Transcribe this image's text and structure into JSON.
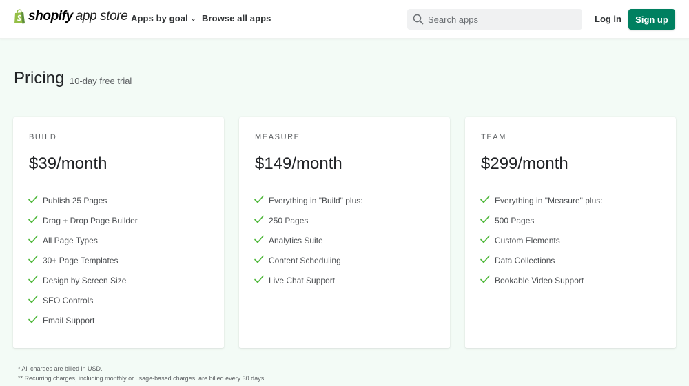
{
  "header": {
    "logo_word": "shopify",
    "logo_sub": "app store",
    "nav": [
      {
        "label": "Apps by goal",
        "has_dropdown": true
      },
      {
        "label": "Browse all apps",
        "has_dropdown": false
      }
    ],
    "search": {
      "placeholder": "Search apps",
      "value": "",
      "icon": "search-icon"
    },
    "login_label": "Log in",
    "signup_label": "Sign up",
    "brand_color": "#008060",
    "logo_color": "#95bf47"
  },
  "pricing": {
    "title": "Pricing",
    "trial": "10-day free trial",
    "plans": [
      {
        "name": "BUILD",
        "price": "$39/month",
        "features": [
          "Publish 25 Pages",
          "Drag + Drop Page Builder",
          "All Page Types",
          "30+ Page Templates",
          "Design by Screen Size",
          "SEO Controls",
          "Email Support"
        ]
      },
      {
        "name": "MEASURE",
        "price": "$149/month",
        "features": [
          "Everything in \"Build\" plus:",
          "250 Pages",
          "Analytics Suite",
          "Content Scheduling",
          "Live Chat Support"
        ]
      },
      {
        "name": "TEAM",
        "price": "$299/month",
        "features": [
          "Everything in \"Measure\" plus:",
          "500 Pages",
          "Custom Elements",
          "Data Collections",
          "Bookable Video Support"
        ]
      }
    ],
    "check_color": "#50b83c"
  },
  "footnotes": [
    "* All charges are billed in USD.",
    "** Recurring charges, including monthly or usage-based charges, are billed every 30 days."
  ]
}
